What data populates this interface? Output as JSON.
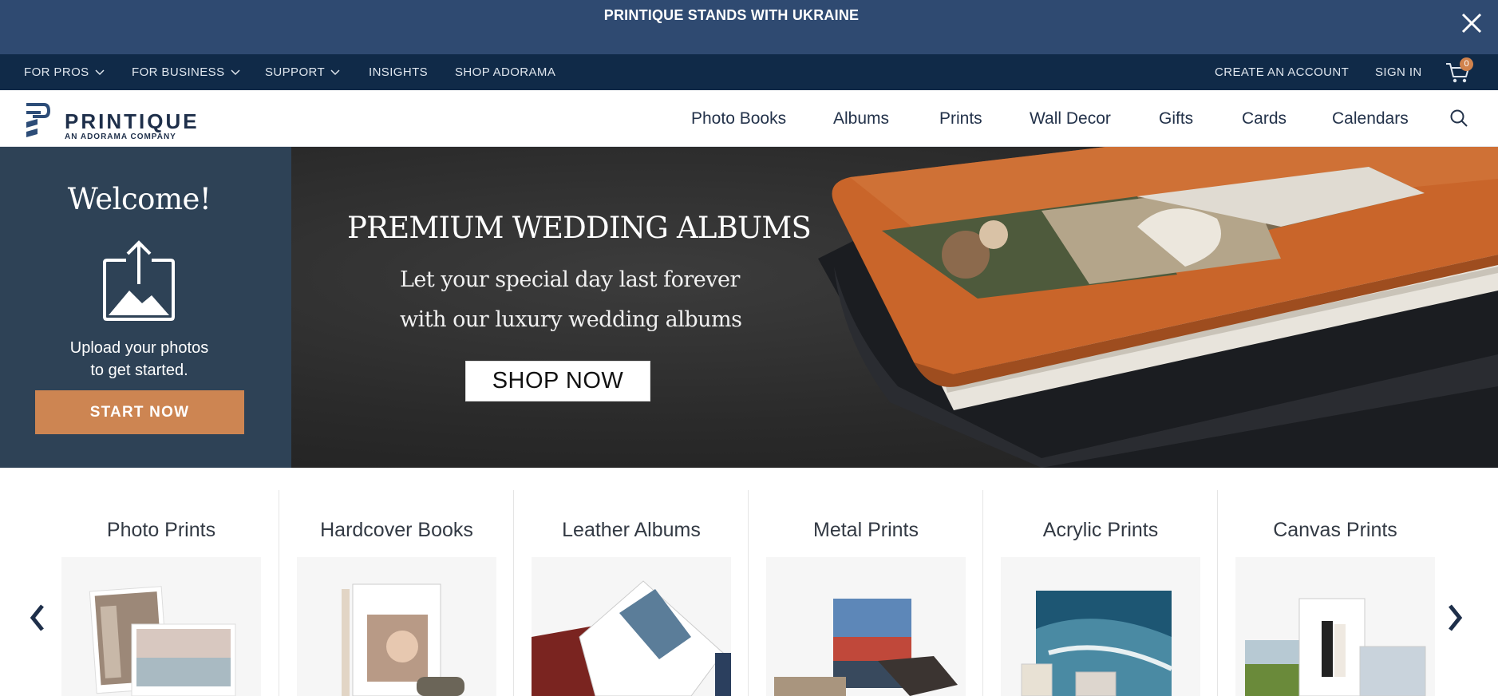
{
  "announcement": {
    "text": "PRINTIQUE STANDS WITH UKRAINE",
    "close_icon": "close-icon"
  },
  "utility_nav": {
    "left": [
      {
        "label": "FOR PROS",
        "dropdown": true
      },
      {
        "label": "FOR BUSINESS",
        "dropdown": true
      },
      {
        "label": "SUPPORT",
        "dropdown": true
      },
      {
        "label": "INSIGHTS",
        "dropdown": false
      },
      {
        "label": "SHOP ADORAMA",
        "dropdown": false
      }
    ],
    "create_account": "CREATE AN ACCOUNT",
    "sign_in": "SIGN IN",
    "cart_count": "0",
    "cart_icon": "cart-icon"
  },
  "header": {
    "logo_word": "PRINTIQUE",
    "logo_sub": "AN ADORAMA COMPANY",
    "nav": [
      "Photo Books",
      "Albums",
      "Prints",
      "Wall Decor",
      "Gifts",
      "Cards",
      "Calendars"
    ],
    "search_icon": "search-icon"
  },
  "welcome": {
    "title": "Welcome!",
    "text_line1": "Upload your photos",
    "text_line2": "to get started.",
    "button": "START NOW",
    "icon": "upload-photo-icon"
  },
  "banner": {
    "title": "PREMIUM WEDDING ALBUMS",
    "sub_line1": "Let your special day last forever",
    "sub_line2": "with our luxury wedding albums",
    "button": "SHOP NOW"
  },
  "categories": [
    {
      "title": "Photo Prints"
    },
    {
      "title": "Hardcover Books"
    },
    {
      "title": "Leather Albums"
    },
    {
      "title": "Metal Prints"
    },
    {
      "title": "Acrylic Prints"
    },
    {
      "title": "Canvas Prints"
    }
  ],
  "colors": {
    "announcement_bg": "#2f4a71",
    "utility_bg": "#102a48",
    "welcome_bg": "#2e4256",
    "accent": "#cd8552"
  }
}
